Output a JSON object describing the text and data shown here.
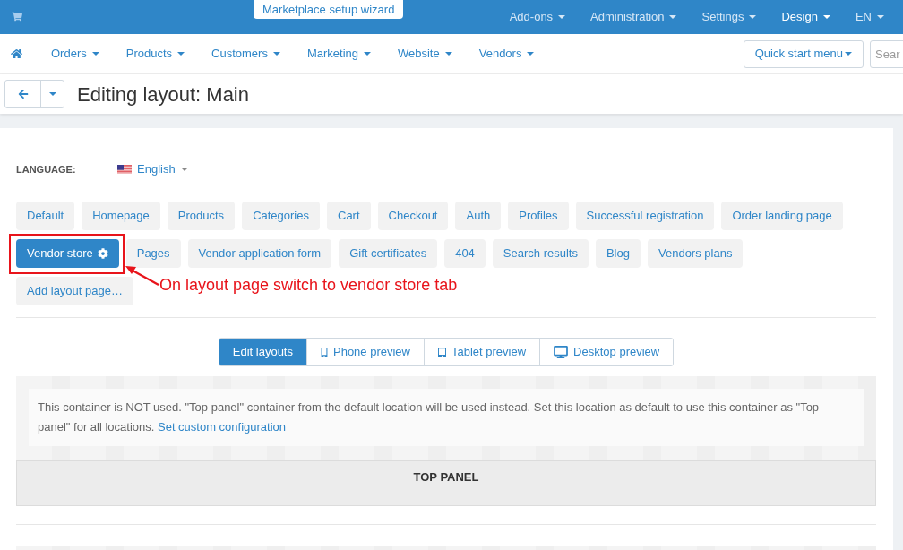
{
  "top_bar": {
    "wizard_button": "Marketplace setup wizard",
    "menu": [
      {
        "label": "Add-ons",
        "selected": false
      },
      {
        "label": "Administration",
        "selected": false
      },
      {
        "label": "Settings",
        "selected": false
      },
      {
        "label": "Design",
        "selected": true
      },
      {
        "label": "EN",
        "selected": false
      }
    ]
  },
  "main_nav": {
    "items": [
      "Orders",
      "Products",
      "Customers",
      "Marketing",
      "Website",
      "Vendors"
    ],
    "quick_start": "Quick start menu",
    "search": {
      "placeholder": "Sear"
    }
  },
  "page_header": {
    "title": "Editing layout: Main"
  },
  "language": {
    "label": "LANGUAGE:",
    "value": "English"
  },
  "layout_pages": [
    {
      "label": "Default",
      "selected": false
    },
    {
      "label": "Homepage",
      "selected": false
    },
    {
      "label": "Products",
      "selected": false
    },
    {
      "label": "Categories",
      "selected": false
    },
    {
      "label": "Cart",
      "selected": false
    },
    {
      "label": "Checkout",
      "selected": false
    },
    {
      "label": "Auth",
      "selected": false
    },
    {
      "label": "Profiles",
      "selected": false
    },
    {
      "label": "Successful registration",
      "selected": false
    },
    {
      "label": "Order landing page",
      "selected": false
    },
    {
      "label": "Vendor store",
      "selected": true
    },
    {
      "label": "Pages",
      "selected": false
    },
    {
      "label": "Vendor application form",
      "selected": false
    },
    {
      "label": "Gift certificates",
      "selected": false
    },
    {
      "label": "404",
      "selected": false
    },
    {
      "label": "Search results",
      "selected": false
    },
    {
      "label": "Blog",
      "selected": false
    },
    {
      "label": "Vendors plans",
      "selected": false
    }
  ],
  "add_page_button": "Add layout page…",
  "annotation": {
    "text": "On layout page switch to vendor store tab"
  },
  "view_modes": [
    {
      "kind": "edit",
      "label": "Edit layouts",
      "selected": true
    },
    {
      "kind": "phone",
      "label": "Phone preview",
      "selected": false
    },
    {
      "kind": "tablet",
      "label": "Tablet preview",
      "selected": false
    },
    {
      "kind": "desktop",
      "label": "Desktop preview",
      "selected": false
    }
  ],
  "notice": {
    "text": "This container is NOT used. \"Top panel\" container from the default location will be used instead. Set this location as default to use this container as \"Top panel\" for all locations.",
    "link": "Set custom configuration"
  },
  "container": {
    "title": "TOP PANEL"
  }
}
